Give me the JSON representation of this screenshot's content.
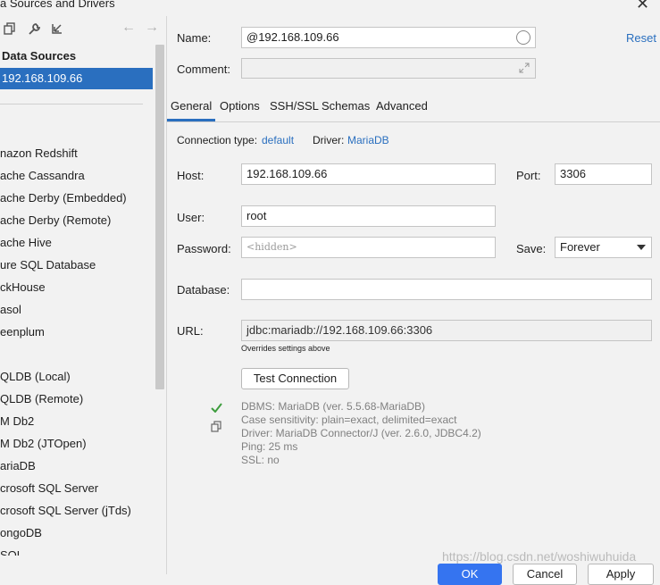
{
  "window": {
    "title": "a Sources and Drivers",
    "close_glyph": "✕"
  },
  "sidebar": {
    "toolbar": {
      "copy_icon": "copy-icon",
      "wrench_icon": "wrench-icon",
      "import_icon": "import-icon",
      "back_glyph": "←",
      "forward_glyph": "→"
    },
    "section_title": "Data Sources",
    "selected_source": "192.168.109.66",
    "drivers": [
      "nazon Redshift",
      "ache Cassandra",
      "ache Derby (Embedded)",
      "ache Derby (Remote)",
      "ache Hive",
      "ure SQL Database",
      "ckHouse",
      "asol",
      "eenplum",
      "QLDB (Local)",
      "QLDB (Remote)",
      "M Db2",
      "M Db2 (JTOpen)",
      "ariaDB",
      "crosoft SQL Server",
      "crosoft SQL Server (jTds)",
      "ongoDB",
      "SQL"
    ]
  },
  "form": {
    "name_label": "Name:",
    "name_value": "@192.168.109.66",
    "reset_label": "Reset",
    "comment_label": "Comment:",
    "tabs": [
      "General",
      "Options",
      "SSH/SSL",
      "Schemas",
      "Advanced"
    ],
    "active_tab": "General",
    "connection_type_label": "Connection type:",
    "connection_type_value": "default",
    "driver_label": "Driver:",
    "driver_value": "MariaDB",
    "host_label": "Host:",
    "host_value": "192.168.109.66",
    "port_label": "Port:",
    "port_value": "3306",
    "user_label": "User:",
    "user_value": "root",
    "password_label": "Password:",
    "password_placeholder": "<hidden>",
    "save_label": "Save:",
    "save_value": "Forever",
    "database_label": "Database:",
    "database_value": "",
    "url_label": "URL:",
    "url_value": "jdbc:mariadb://192.168.109.66:3306",
    "url_hint": "Overrides settings above",
    "test_button": "Test Connection",
    "test_result": [
      "DBMS: MariaDB (ver. 5.5.68-MariaDB)",
      "Case sensitivity: plain=exact, delimited=exact",
      "Driver: MariaDB Connector/J (ver. 2.6.0, JDBC4.2)",
      "Ping: 25 ms",
      "SSL: no"
    ]
  },
  "footer": {
    "ok_label": "OK",
    "cancel_label": "Cancel",
    "apply_label": "Apply"
  },
  "watermark": "https://blog.csdn.net/woshiwuhuida",
  "colors": {
    "accent": "#2a6fbf",
    "success": "#3e9d3e"
  }
}
